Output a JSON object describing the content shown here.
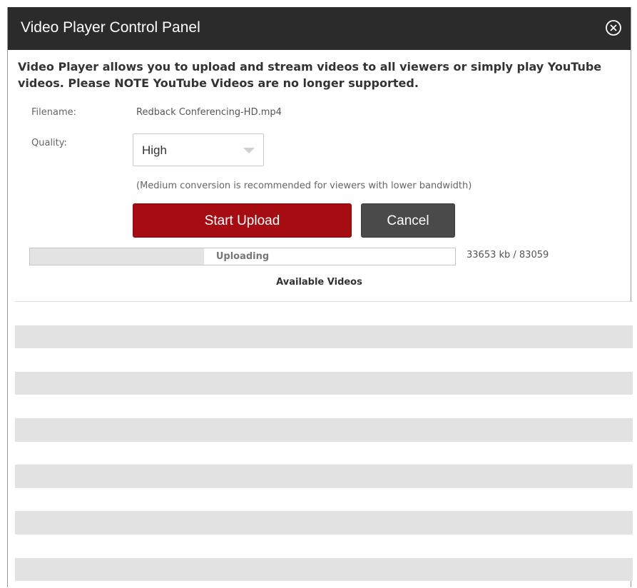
{
  "window": {
    "title": "Video Player Control Panel",
    "close_icon": "close-circle-icon"
  },
  "intro_text": "Video Player allows you to upload and stream videos to all viewers or simply play YouTube videos. Please NOTE YouTube Videos are no longer supported.",
  "form": {
    "filename_label": "Filename:",
    "filename_value": "Redback Conferencing-HD.mp4",
    "quality_label": "Quality:",
    "quality_value": "High",
    "quality_hint": "(Medium conversion is recommended for viewers with lower bandwidth)"
  },
  "buttons": {
    "start_upload": "Start Upload",
    "cancel": "Cancel"
  },
  "upload": {
    "status": "Uploading",
    "progress_fraction": 0.41,
    "count_text": "33653 kb / 83059"
  },
  "videos": {
    "title": "Available Videos",
    "rows": [
      "",
      "",
      "",
      "",
      "",
      "",
      "",
      "",
      "",
      "",
      "",
      ""
    ]
  },
  "colors": {
    "titlebar": "#2b2b2b",
    "primary_button": "#a60d13",
    "secondary_button": "#4a4a4a",
    "row_stripe": "#e2e2e2"
  }
}
